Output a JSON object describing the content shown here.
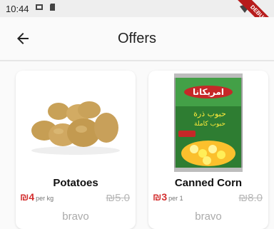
{
  "status": {
    "time": "10:44"
  },
  "debug_label": "DEBUG",
  "appbar": {
    "title": "Offers"
  },
  "offers": [
    {
      "name": "Potatoes",
      "price": "₪4",
      "unit": "per kg",
      "old_price": "₪5.0",
      "vendor": "bravo"
    },
    {
      "name": "Canned Corn",
      "price": "₪3",
      "unit": "per 1",
      "old_price": "₪8.0",
      "vendor": "bravo"
    }
  ],
  "product_labels": {
    "can_brand": "امريكانا",
    "can_title": "حبوب ذرة",
    "can_subtitle": "حبوب كاملة"
  },
  "colors": {
    "discount_red": "#d32f2f",
    "debug_red": "#b71c1c"
  }
}
